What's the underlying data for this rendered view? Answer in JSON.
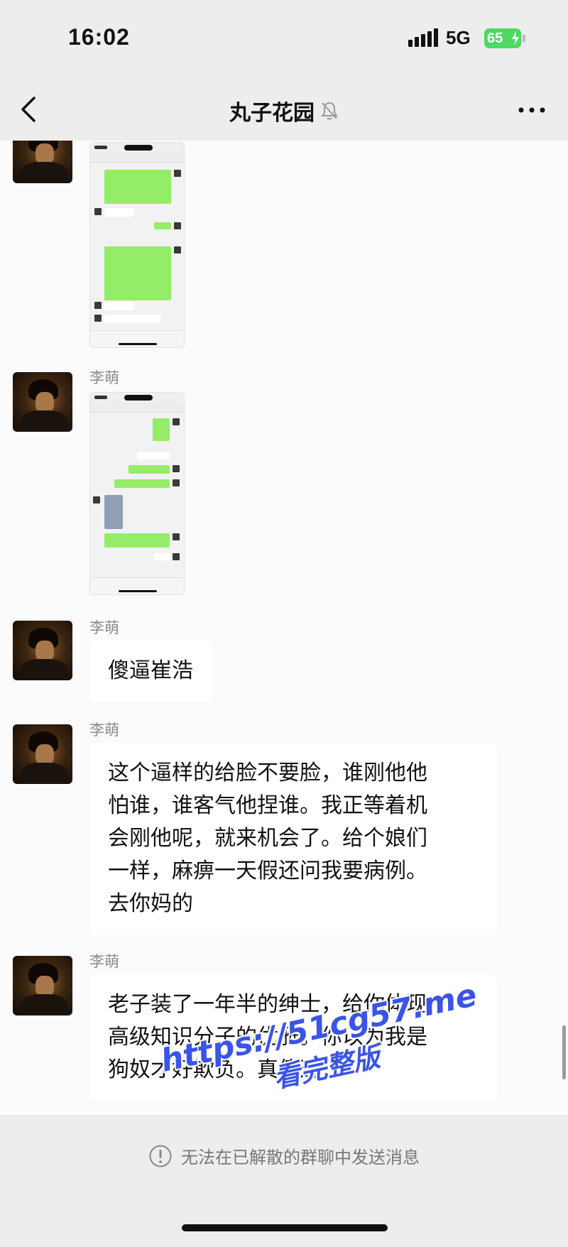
{
  "status_bar": {
    "time": "16:02",
    "network": "5G",
    "battery": "65"
  },
  "header": {
    "title": "丸子花园"
  },
  "messages": [
    {
      "type": "image",
      "sender": ""
    },
    {
      "type": "image",
      "sender": "李萌"
    },
    {
      "type": "text",
      "sender": "李萌",
      "text": "傻逼崔浩"
    },
    {
      "type": "text",
      "sender": "李萌",
      "lines": [
        "这个逼样的给脸不要脸，谁刚他他",
        "怕谁，谁客气他捏谁。我正等着机",
        "会刚他呢，就来机会了。给个娘们",
        "一样，麻痹一天假还问我要病例。",
        "去你妈的"
      ]
    },
    {
      "type": "text",
      "sender": "李萌",
      "lines": [
        "老子装了一年半的绅士，给你体现",
        "高级知识分子的优雅。你以为我是",
        "狗奴才好欺负。真傻逼"
      ]
    }
  ],
  "footer": {
    "notice": "无法在已解散的群聊中发送消息"
  },
  "watermark": {
    "line1": "https://51cg57.me",
    "line2": "看完整版"
  },
  "colors": {
    "accent_green": "#95ec69",
    "battery_green": "#4cd964",
    "watermark_blue": "#3b54e6"
  }
}
